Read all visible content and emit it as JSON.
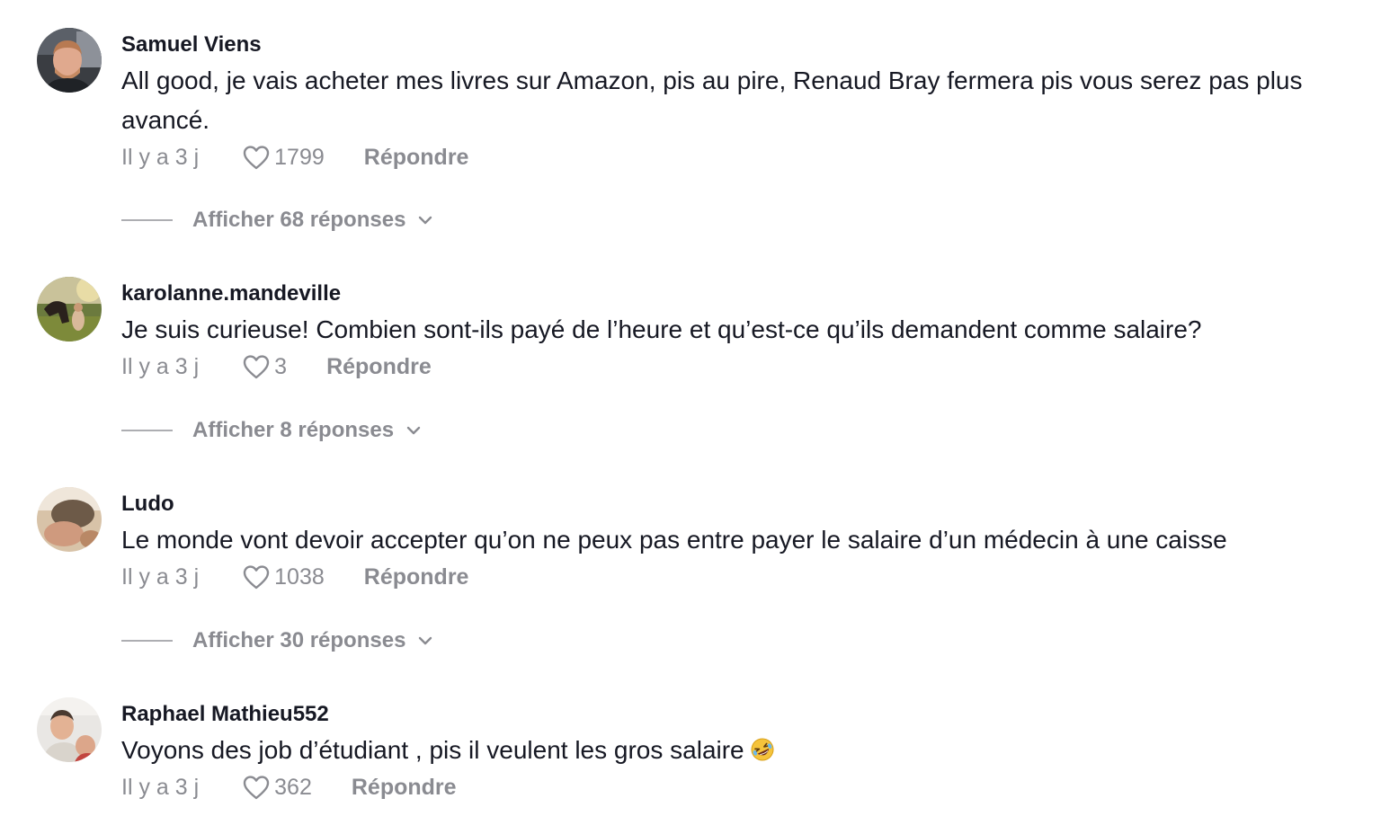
{
  "comments": [
    {
      "username": "Samuel Viens",
      "text": "All good, je vais acheter mes livres sur Amazon, pis au pire, Renaud Bray fermera pis vous serez pas plus avancé.",
      "time": "Il y a 3 j",
      "likes": "1799",
      "reply_label": "Répondre",
      "view_replies": "Afficher 68 réponses",
      "avatar_icon": "profile-photo-man-in-car"
    },
    {
      "username": "karolanne.mandeville",
      "text": "Je suis curieuse! Combien sont-ils payé de l’heure et qu’est-ce qu’ils demandent comme salaire?",
      "time": "Il y a 3 j",
      "likes": "3",
      "reply_label": "Répondre",
      "view_replies": "Afficher 8 réponses",
      "avatar_icon": "profile-photo-horse-outdoors"
    },
    {
      "username": "Ludo",
      "text": "Le monde vont devoir accepter qu’on ne peux pas entre payer le salaire d’un médecin à une caisse",
      "time": "Il y a 3 j",
      "likes": "1038",
      "reply_label": "Répondre",
      "view_replies": "Afficher 30 réponses",
      "avatar_icon": "profile-photo-person"
    },
    {
      "username": "Raphael Mathieu552",
      "text": "Voyons des job d’étudiant , pis il veulent les gros salaire",
      "text_emoji": "rolling-on-floor-laughing-emoji",
      "time": "Il y a 3 j",
      "likes": "362",
      "reply_label": "Répondre",
      "avatar_icon": "profile-photo-two-people"
    }
  ],
  "colors": {
    "text_primary": "#161823",
    "text_secondary": "#8a8b91",
    "background": "#ffffff"
  },
  "icons": {
    "like": "heart-outline-icon",
    "expand": "chevron-down-icon"
  }
}
